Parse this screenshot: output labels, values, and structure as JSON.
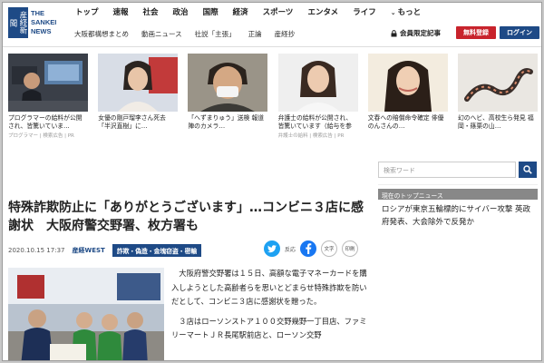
{
  "logo": {
    "kanji": "産経新聞",
    "text_line1": "THE",
    "text_line2": "SANKEI",
    "text_line3": "NEWS"
  },
  "main_nav": [
    "トップ",
    "速報",
    "社会",
    "政治",
    "国際",
    "経済",
    "スポーツ",
    "エンタメ",
    "ライフ"
  ],
  "more_label": "もっと",
  "sub_nav": [
    "大阪都構想まとめ",
    "動画ニュース",
    "社説「主張」",
    "正論",
    "産経抄"
  ],
  "member_link": "会員限定記事",
  "register_label": "無料登録",
  "login_label": "ログイン",
  "recommendations": [
    {
      "title": "プログラマーの給料が公開され、皆驚いていま…",
      "meta": "プログラマー | 検索広告 | PR"
    },
    {
      "title": "女優の剛戸瑠李さん死去 「半沢直樹」に…",
      "meta": ""
    },
    {
      "title": "「へずまりゅう」送検 報道陣のカメラ…",
      "meta": ""
    },
    {
      "title": "弁護士の給料が公開され、皆驚いています（給与を参照）",
      "meta": "弁護士の給料 | 検索広告 | PR"
    },
    {
      "title": "文春への賠償命令確定 俳優のんさんの…",
      "meta": ""
    },
    {
      "title": "幻のヘビ、高校生ら発見 福岡・篠栗の山…",
      "meta": ""
    }
  ],
  "sidebar": {
    "search_placeholder": "検索ワード",
    "topnews_heading": "現在のトップニュース",
    "topnews_item": "ロシアが東京五輪標的にサイバー攻撃 英政府発表、大会除外で反発か"
  },
  "article": {
    "title": "特殊詐欺防止に「ありがとうございます」…コンビニ３店に感謝状　大阪府警交野署、枚方署も",
    "date": "2020.10.15 17:37",
    "source": "産経WEST",
    "category": "詐欺・偽造・金塊窃盗・密輸",
    "share_label": "反応",
    "print_label": "印刷",
    "text_size_label": "文字",
    "paragraphs": [
      "大阪府警交野署は１５日、高額な電子マネーカードを購入しようとした高齢者らを思いとどまらせ特殊詐欺を防いだとして、コンビニ３店に感謝状を贈った。",
      "３店はローソンストア１００交野幾野一丁目店、ファミリーマートＪＲ長尾駅前店と、ローソン交野"
    ]
  },
  "colors": {
    "brand_blue": "#1e4a86",
    "register_red": "#c8232c"
  }
}
